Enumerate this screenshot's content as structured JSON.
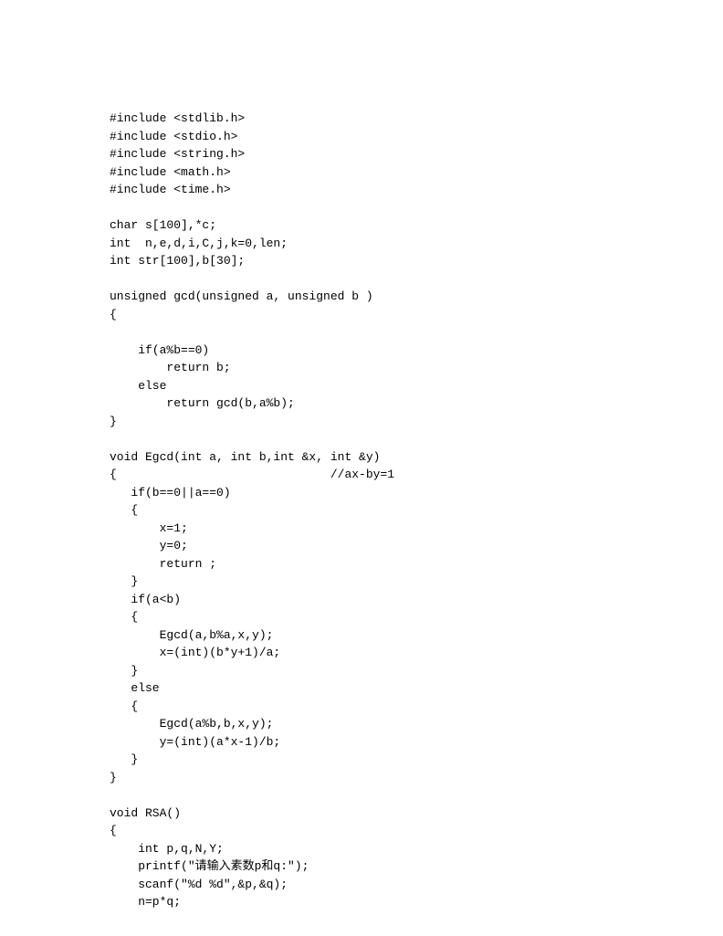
{
  "code": "#include <stdlib.h>\n#include <stdio.h>\n#include <string.h>\n#include <math.h>\n#include <time.h>\n\nchar s[100],*c;\nint  n,e,d,i,C,j,k=0,len;\nint str[100],b[30];\n\nunsigned gcd(unsigned a, unsigned b )\n{\n\n    if(a%b==0)\n        return b;\n    else\n        return gcd(b,a%b);\n}\n\nvoid Egcd(int a, int b,int &x, int &y)\n{                              //ax-by=1\n   if(b==0||a==0)\n   {\n       x=1;\n       y=0;\n       return ;\n   }\n   if(a<b)\n   {\n       Egcd(a,b%a,x,y);\n       x=(int)(b*y+1)/a;\n   }\n   else\n   {\n       Egcd(a%b,b,x,y);\n       y=(int)(a*x-1)/b;\n   }\n}\n\nvoid RSA()\n{\n    int p,q,N,Y;\n    printf(\"请输入素数p和q:\");\n    scanf(\"%d %d\",&p,&q);\n    n=p*q;"
}
